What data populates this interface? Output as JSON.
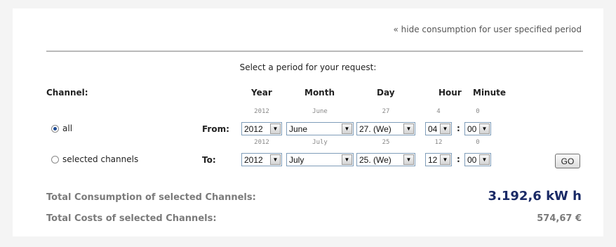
{
  "hide_link": "« hide consumption for user specified period",
  "prompt": "Select a period for your request:",
  "headers": {
    "channel": "Channel:",
    "year": "Year",
    "month": "Month",
    "day": "Day",
    "hour": "Hour",
    "minute": "Minute"
  },
  "channels": {
    "all": "all",
    "selected": "selected channels",
    "selected_value": "all"
  },
  "from": {
    "label": "From:",
    "hints": {
      "year": "2012",
      "month": "June",
      "day": "27",
      "hour": "4",
      "minute": "0"
    },
    "year": "2012",
    "month": "June",
    "day": "27. (We)",
    "hour": "04",
    "minute": "00"
  },
  "to": {
    "label": "To:",
    "hints": {
      "year": "2012",
      "month": "July",
      "day": "25",
      "hour": "12",
      "minute": "0"
    },
    "year": "2012",
    "month": "July",
    "day": "25. (We)",
    "hour": "12",
    "minute": "00"
  },
  "time_separator": ":",
  "go_label": "GO",
  "totals": {
    "consumption_label": "Total Consumption of selected Channels:",
    "consumption_value": "3.192,6 kW h",
    "costs_label": "Total Costs of selected Channels:",
    "costs_value": "574,67 €"
  },
  "colors": {
    "total_value": "#1a2a66",
    "muted_label": "#7b7b7b",
    "radio_dot": "#1e4b94"
  }
}
